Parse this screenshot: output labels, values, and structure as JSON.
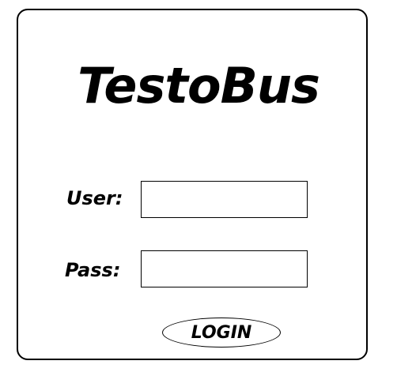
{
  "app": {
    "title": "TestoBus"
  },
  "login_form": {
    "user_label": "User:",
    "user_value": "",
    "pass_label": "Pass:",
    "pass_value": "",
    "login_button_label": "LOGIN"
  }
}
